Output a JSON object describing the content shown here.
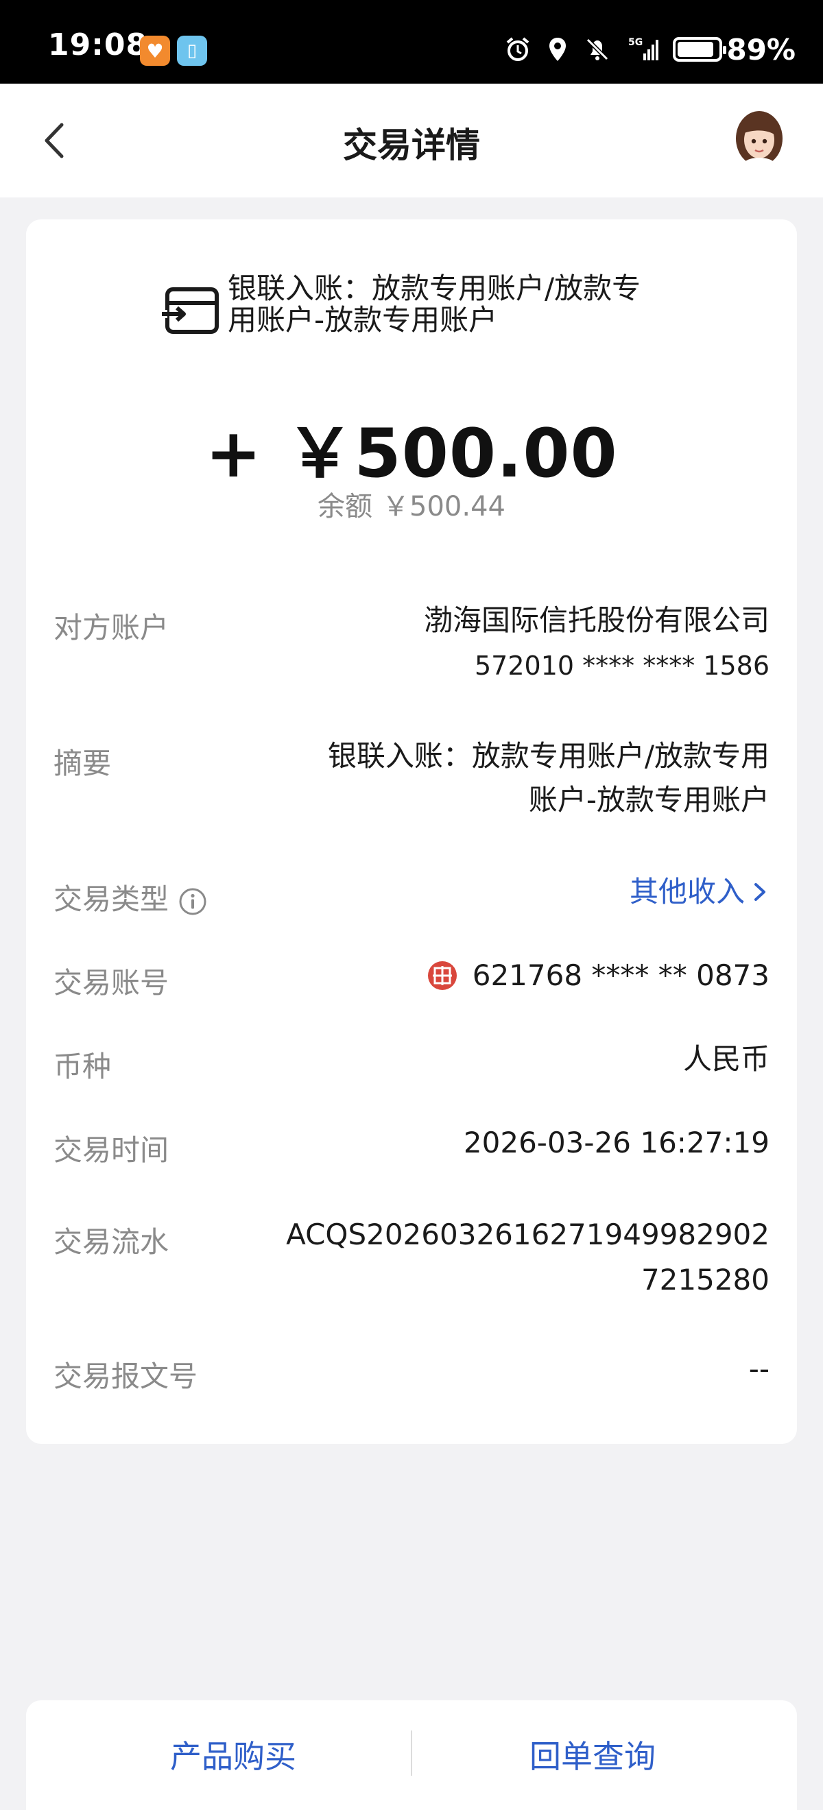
{
  "status_bar": {
    "time": "19:08",
    "battery_percent": "89%",
    "battery_level": 0.89,
    "network": "5G",
    "icons": [
      "heart-app-icon",
      "book-app-icon",
      "alarm-icon",
      "location-icon",
      "mute-icon",
      "signal-icon",
      "battery-icon"
    ]
  },
  "header": {
    "title": "交易详情",
    "back_icon": "chevron-left-icon",
    "avatar_icon": "assistant-avatar"
  },
  "transaction": {
    "icon": "transfer-in-card-icon",
    "title": "银联入账：放款专用账户/放款专用账户-放款专用账户",
    "amount": "+ ￥500.00",
    "balance_label": "余额",
    "balance_value": "￥500.44"
  },
  "details": {
    "counterparty": {
      "label": "对方账户",
      "name": "渤海国际信托股份有限公司",
      "account": "572010 **** **** 1586"
    },
    "summary": {
      "label": "摘要",
      "line1": "银联入账：放款专用账户/放款专用",
      "line2": "账户-放款专用账户"
    },
    "type": {
      "label": "交易类型",
      "value": "其他收入"
    },
    "account": {
      "label": "交易账号",
      "value": "621768 **** ** 0873",
      "bank_icon": "citic-bank-logo-icon"
    },
    "currency": {
      "label": "币种",
      "value": "人民币"
    },
    "time": {
      "label": "交易时间",
      "value": "2026-03-26 16:27:19"
    },
    "serial": {
      "label": "交易流水",
      "line1": "ACQS2026032616271949982902",
      "line2": "7215280"
    },
    "message_no": {
      "label": "交易报文号",
      "value": "--"
    }
  },
  "bottom_bar": {
    "left_button": "产品购买",
    "right_button": "回单查询"
  },
  "colors": {
    "accent_blue": "#2f5fc9",
    "page_bg": "#f2f2f4",
    "label_gray": "#8a8a8a",
    "bank_red": "#d9473c"
  }
}
